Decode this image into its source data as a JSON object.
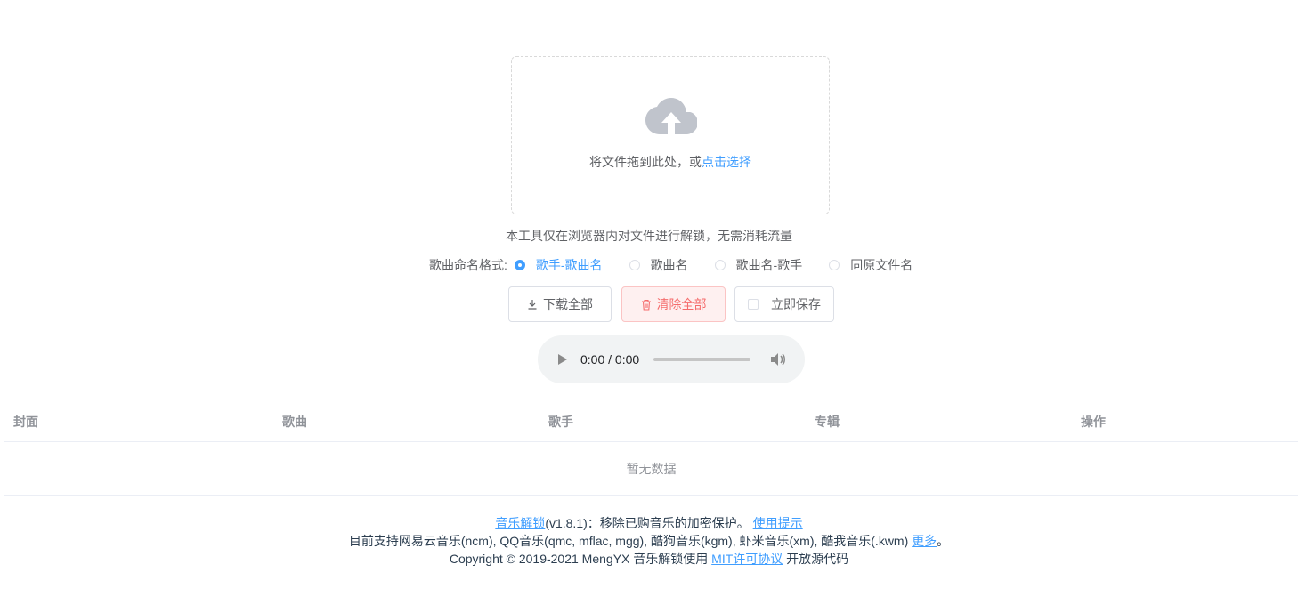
{
  "upload": {
    "icon": "upload-cloud-icon",
    "text": "将文件拖到此处，或",
    "link": "点击选择"
  },
  "tip": "本工具仅在浏览器内对文件进行解锁，无需消耗流量",
  "naming": {
    "label": "歌曲命名格式:",
    "options": [
      "歌手-歌曲名",
      "歌曲名",
      "歌曲名-歌手",
      "同原文件名"
    ],
    "selected": "歌手-歌曲名"
  },
  "buttons": {
    "download": "下载全部",
    "clear": "清除全部",
    "save": "立即保存"
  },
  "audio": {
    "time": "0:00 / 0:00"
  },
  "table": {
    "headers": [
      "封面",
      "歌曲",
      "歌手",
      "专辑",
      "操作"
    ],
    "empty": "暂无数据"
  },
  "footer": {
    "line1_link": "音乐解锁",
    "line1_text": "(v1.8.1)：移除已购音乐的加密保护。",
    "line1_link2": "使用提示",
    "line2_text": "目前支持网易云音乐(ncm), QQ音乐(qmc, mflac, mgg), 酷狗音乐(kgm), 虾米音乐(xm), 酷我音乐(.kwm)",
    "line2_link": "更多",
    "line2_end": "。",
    "line3_text": "Copyright © 2019-2021 MengYX 音乐解锁使用",
    "line3_link": "MIT许可协议",
    "line3_end": "开放源代码"
  },
  "colors": {
    "primary": "#409eff",
    "danger": "#f56c6c"
  }
}
